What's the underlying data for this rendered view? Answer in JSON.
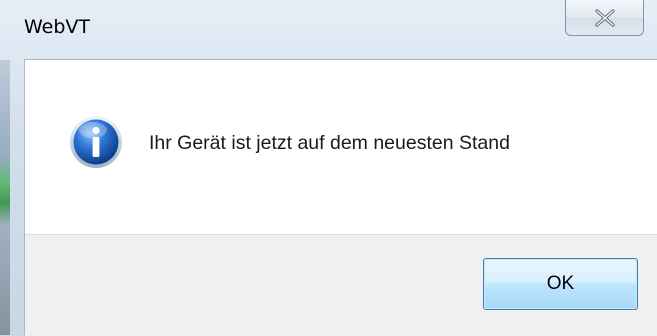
{
  "window": {
    "title": "WebVT"
  },
  "dialog": {
    "icon": "information-icon",
    "message": "Ihr Gerät ist jetzt auf dem neuesten Stand",
    "ok_label": "OK"
  },
  "colors": {
    "accent": "#3c7fb1",
    "icon_blue": "#1e5fb4"
  }
}
